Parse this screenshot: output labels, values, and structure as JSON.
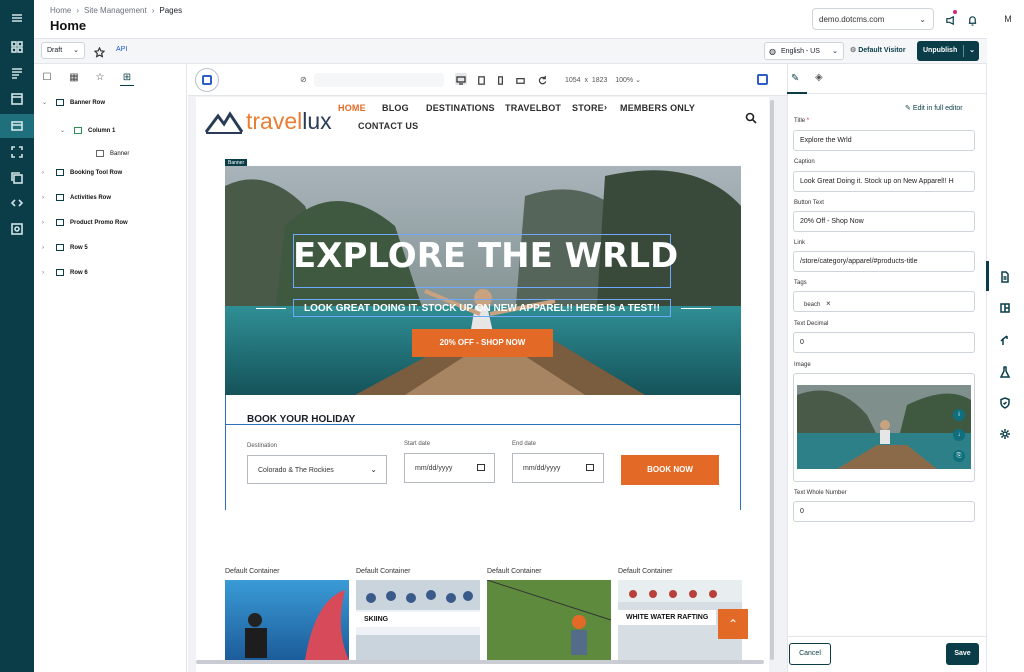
{
  "header": {
    "breadcrumb": [
      "Home",
      "Site Management",
      "Pages"
    ],
    "title": "Home",
    "site": "demo.dotcms.com",
    "avatar": "M"
  },
  "toolbar": {
    "status": "Draft",
    "api": "API",
    "language": "English - US",
    "visitor": "Default Visitor",
    "unpublish": "Unpublish"
  },
  "tree": {
    "rows": [
      "Banner Row",
      "Column 1",
      "Banner",
      "Booking Tool Row",
      "Activities Row",
      "Product Promo Row",
      "Row 5",
      "Row 6"
    ]
  },
  "canvas": {
    "width": "1054",
    "x": "x",
    "height": "1823",
    "zoom": "100%"
  },
  "site": {
    "logo_a": "travel",
    "logo_b": "lux",
    "nav": [
      "HOME",
      "BLOG",
      "DESTINATIONS",
      "TRAVELBOT",
      "STORE",
      "MEMBERS ONLY",
      "CONTACT US"
    ],
    "banner_tag": "Banner",
    "banner_title": "EXPLORE THE WRLD",
    "banner_sub": "LOOK GREAT DOING IT. STOCK UP ON NEW APPAREL!! HERE IS A TEST!!",
    "banner_btn": "20% OFF - SHOP NOW",
    "book_title": "BOOK YOUR HOLIDAY",
    "dest_label": "Destination",
    "dest_value": "Colorado & The Rockies",
    "start_label": "Start date",
    "end_label": "End date",
    "date_placeholder": "mm/dd/yyyy",
    "book_btn": "BOOK NOW",
    "tiles": [
      {
        "label": "Default Container",
        "caption": ""
      },
      {
        "label": "Default Container",
        "caption": "SKIING"
      },
      {
        "label": "Default Container",
        "caption": ""
      },
      {
        "label": "Default Container",
        "caption": "WHITE WATER RAFTING"
      }
    ]
  },
  "form": {
    "edit_full": "Edit in full editor",
    "title_label": "Title",
    "title_required": "*",
    "title_value": "Explore the Wrld",
    "caption_label": "Caption",
    "caption_value": "Look Great Doing it. Stock up on New Apparel!! H",
    "button_label": "Button Text",
    "button_value": "20% Off - Shop Now",
    "link_label": "Link",
    "link_value": "/store/category/apparel/#products-title",
    "tags_label": "Tags",
    "tag": "beach",
    "decimal_label": "Text Decimal",
    "decimal_value": "0",
    "image_label": "Image",
    "whole_label": "Text Whole Number",
    "whole_value": "0",
    "cancel": "Cancel",
    "save": "Save"
  }
}
